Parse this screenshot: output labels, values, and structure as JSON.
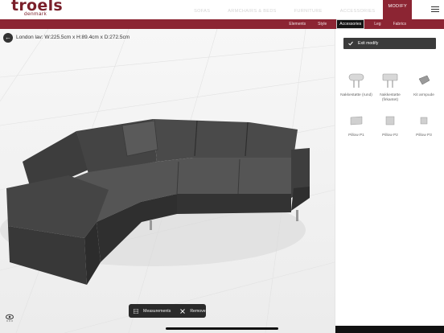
{
  "header": {
    "logo_main": "troels",
    "logo_sub": "denmark",
    "nav": [
      "SOFAS",
      "ARMCHAIRS & BEDS",
      "FURNITURE",
      "ACCESSORIES",
      "MODIFY"
    ],
    "active_nav": "MODIFY"
  },
  "subnav": {
    "tabs": [
      "Elements",
      "Style",
      "Accessories",
      "Leg",
      "Fabrics"
    ],
    "active_tab": "Accessories"
  },
  "canvas": {
    "dimensions": "London lav: W:225.5cm x H:89.4cm x D:272.5cm",
    "toolbar": {
      "measurements_label": "Measurements",
      "remove_label": "Remove"
    }
  },
  "panel": {
    "exit_label": "Exit modify",
    "accessories": [
      {
        "label": "Nakkestøtte (rund)",
        "icon": "headrest-round-icon"
      },
      {
        "label": "Nakkestøtte (firkantet)",
        "icon": "headrest-square-icon"
      },
      {
        "label": "Kit armpude",
        "icon": "armpad-icon"
      },
      {
        "label": "Pillow P1",
        "icon": "pillow-p1-icon"
      },
      {
        "label": "Pillow P2",
        "icon": "pillow-p2-icon"
      },
      {
        "label": "Pillow P3",
        "icon": "pillow-p3-icon"
      }
    ]
  },
  "colors": {
    "brand": "#8c2533",
    "dark_ui": "#2a2a2a"
  }
}
